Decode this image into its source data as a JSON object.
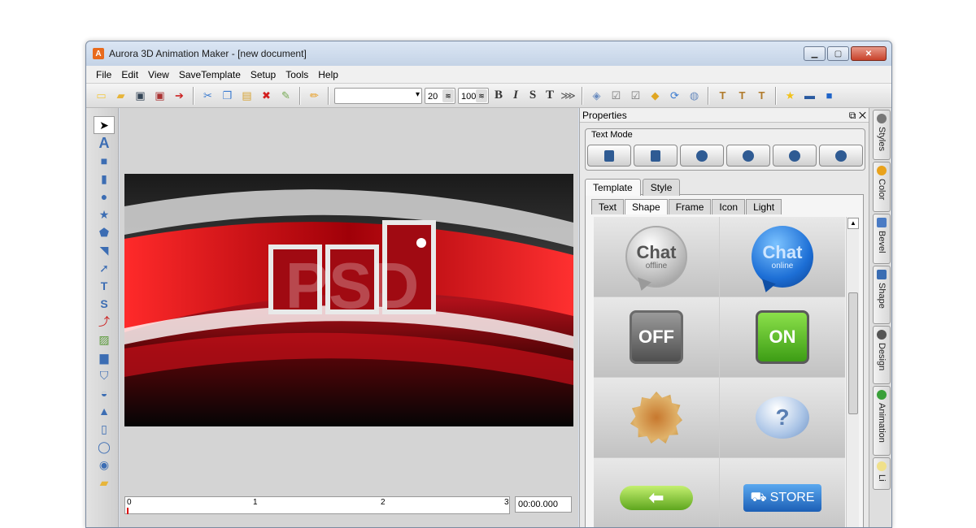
{
  "window": {
    "title": "Aurora 3D Animation Maker - [new document]",
    "app_icon": "A"
  },
  "menu": [
    "File",
    "Edit",
    "View",
    "SaveTemplate",
    "Setup",
    "Tools",
    "Help"
  ],
  "toolbar": {
    "font_size": "20",
    "depth": "100",
    "bold": "B",
    "italic": "I",
    "strike": "S",
    "format_t": "T"
  },
  "preview": {
    "logo_text": "PSD"
  },
  "timeline": {
    "ticks": [
      "0",
      "1",
      "2",
      "3"
    ],
    "time": "00:00.000"
  },
  "properties": {
    "title": "Properties",
    "text_mode_label": "Text Mode",
    "tabs": [
      "Template",
      "Style"
    ],
    "subtabs": [
      "Text",
      "Shape",
      "Frame",
      "Icon",
      "Light"
    ],
    "gallery": {
      "chat1_big": "Chat",
      "chat1_small": "offline",
      "chat2_big": "Chat",
      "chat2_small": "online",
      "off": "OFF",
      "on": "ON",
      "question": "?",
      "arrow": "⬅",
      "store": "STORE"
    }
  },
  "side_tabs": [
    "Styles",
    "Color",
    "Bevel",
    "Shape",
    "Design",
    "Animation",
    "Li"
  ],
  "colors": {
    "accent": "#3c6db3",
    "preview_red": "#c8101a"
  }
}
